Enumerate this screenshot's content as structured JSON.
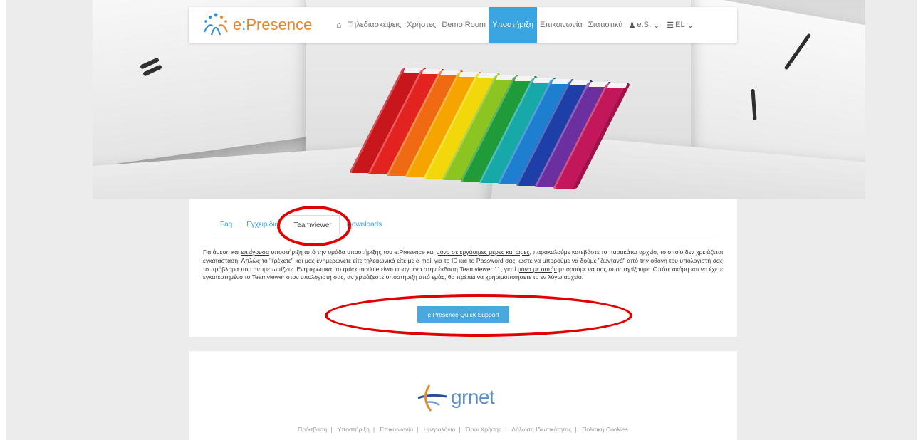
{
  "logo": {
    "brand_main": "e",
    "brand_colon": ":",
    "brand_rest": "Presence"
  },
  "nav": {
    "items": [
      {
        "label": "Τηλεδιασκέψεις",
        "active": false
      },
      {
        "label": "Χρήστες",
        "active": false
      },
      {
        "label": "Demo Room",
        "active": false
      },
      {
        "label": "Υποστήριξη",
        "active": true
      },
      {
        "label": "Επικοινωνία",
        "active": false
      },
      {
        "label": "Στατιστικά",
        "active": false
      }
    ],
    "user_label": "e.S.",
    "lang_label": "EL"
  },
  "tabs": [
    {
      "label": "Faq",
      "active": false
    },
    {
      "label": "Εγχειρίδια",
      "active": false
    },
    {
      "label": "Teamviewer",
      "active": true
    },
    {
      "label": "Downloads",
      "active": false
    }
  ],
  "content": {
    "p1": "Για άμεση και ",
    "u1": "επείγουσα",
    "p2": " υποστήριξη από την ομάδα υποστήριξης του e:Presence και ",
    "u2": "μόνο σε εργάσιμες μέρες και ώρες",
    "p3": ", παρακαλούμε κατεβάστε το παρακάτω αρχείο, το οποίο δεν χρειάζεται εγκατάσταση. Απλώς το \"τρέχετε\" και μας ενημερώνετε είτε τηλεφωνικά είτε με e-mail για το ID και το Password σας, ώστε να μπορούμε να δούμε \"ζωντανά\" από την οθόνη του υπολογιστή σας το πρόβλημα που αντιμετωπίζετε. Ενημερωτικά, το quick module είναι φτιαγμένο στην έκδοση Teamviewer 11, γιατί ",
    "u3": "μόνο με αυτήν",
    "p4": " μπορούμε να σας υποστηρίξουμε. Οπότε ακόμη και να έχετε εγκατεστημένο το Teamviewer στον υπολογιστή σας, αν χρειάζεστε υποστήριξη από εμάς, θα πρέπει να χρησιμοποιήσετε το εν λόγω αρχείο.",
    "button_label": "e:Presence Quick Support"
  },
  "footer": {
    "logo_text": "grnet",
    "links": [
      "Πρόσβαση",
      "Υποστήριξη",
      "Επικοινωνία",
      "Ημερολόγιο",
      "Όροι Χρήσης",
      "Δήλωση Ιδιωτικότητας",
      "Πολιτική Cookies"
    ]
  },
  "colors": {
    "accent": "#3aa5e0",
    "annotation": "#e00000",
    "brand_orange": "#e2862b"
  }
}
